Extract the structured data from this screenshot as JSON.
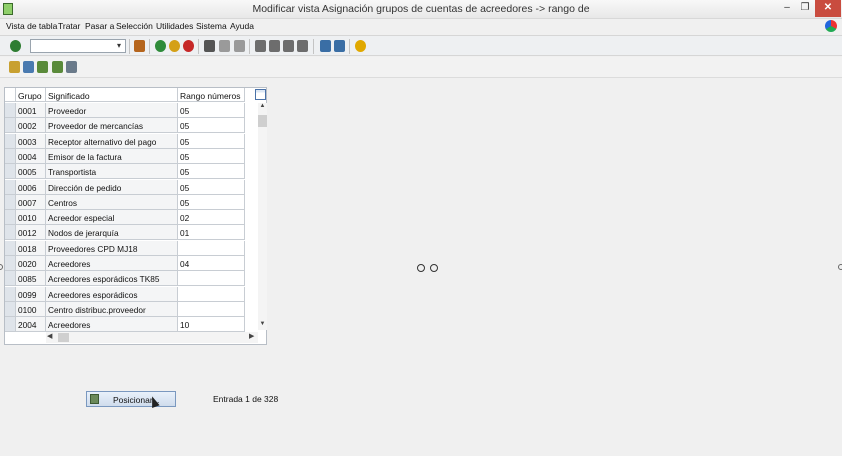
{
  "window": {
    "title": "Modificar vista Asignación grupos de cuentas de acreedores -> rango de",
    "minimize": "–",
    "maximize": "❐",
    "close": "✕"
  },
  "menu": [
    "Vista de tabla",
    "Tratar",
    "Pasar a",
    "Selección",
    "Utilidades",
    "Sistema",
    "Ayuda"
  ],
  "command_field": {
    "value": "",
    "arrow": "▾"
  },
  "table": {
    "headers": {
      "grupo": "Grupo",
      "significado": "Significado",
      "rango": "Rango números"
    },
    "rows": [
      {
        "grupo": "0001",
        "significado": "Proveedor",
        "rango": "05"
      },
      {
        "grupo": "0002",
        "significado": "Proveedor de mercancías",
        "rango": "05"
      },
      {
        "grupo": "0003",
        "significado": "Receptor alternativo del pago",
        "rango": "05"
      },
      {
        "grupo": "0004",
        "significado": "Emisor de la factura",
        "rango": "05"
      },
      {
        "grupo": "0005",
        "significado": "Transportista",
        "rango": "05"
      },
      {
        "grupo": "0006",
        "significado": "Dirección de pedido",
        "rango": "05"
      },
      {
        "grupo": "0007",
        "significado": "Centros",
        "rango": "05"
      },
      {
        "grupo": "0010",
        "significado": "Acreedor especial",
        "rango": "02"
      },
      {
        "grupo": "0012",
        "significado": "Nodos de jerarquía",
        "rango": "01"
      },
      {
        "grupo": "0018",
        "significado": "Proveedores CPD MJ18",
        "rango": ""
      },
      {
        "grupo": "0020",
        "significado": "Acreedores",
        "rango": "04"
      },
      {
        "grupo": "0085",
        "significado": "Acreedores esporádicos TK85",
        "rango": ""
      },
      {
        "grupo": "0099",
        "significado": "Acreedores esporádicos",
        "rango": ""
      },
      {
        "grupo": "0100",
        "significado": "Centro distribuc.proveedor",
        "rango": ""
      },
      {
        "grupo": "2004",
        "significado": "Acreedores",
        "rango": "10"
      }
    ]
  },
  "footer": {
    "position_button": "Posicionar...",
    "entry_text": "Entrada 1 de 328"
  },
  "colors": {
    "close_button": "#c94c3f",
    "accent": "#7a98bf"
  }
}
